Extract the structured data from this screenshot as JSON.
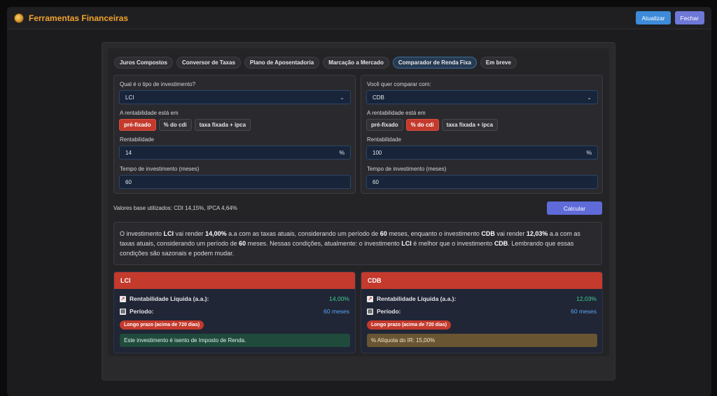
{
  "app": {
    "title": "Ferramentas Financeiras",
    "refresh_label": "Atualizar",
    "close_label": "Fechar"
  },
  "tabs": [
    {
      "label": "Juros Compostos"
    },
    {
      "label": "Conversor de Taxas"
    },
    {
      "label": "Plano de Aposentadoria"
    },
    {
      "label": "Marcação a Mercado"
    },
    {
      "label": "Comparador de Renda Fixa",
      "active": true
    },
    {
      "label": "Em breve"
    }
  ],
  "left_form": {
    "type_label": "Qual é o tipo de investimento?",
    "type_value": "LCI",
    "rate_mode_label": "A rentabilidade está em",
    "rate_modes": [
      "pré-fixado",
      "% do cdi",
      "taxa fixada + ipca"
    ],
    "selected_mode": "pré-fixado",
    "rate_label": "Rentabilidade",
    "rate_value": "14",
    "rate_unit": "%",
    "term_label": "Tempo de investimento (meses)",
    "term_value": "60"
  },
  "right_form": {
    "type_label": "Você quer comparar com:",
    "type_value": "CDB",
    "rate_mode_label": "A rentabilidade está em",
    "rate_modes": [
      "pré-fixado",
      "% do cdi",
      "taxa fixada + ipca"
    ],
    "selected_mode": "% do cdi",
    "rate_label": "Rentabilidade",
    "rate_value": "100",
    "rate_unit": "%",
    "term_label": "Tempo de investimento (meses)",
    "term_value": "60"
  },
  "base_values": "Valores base utilizados: CDI 14,15%, IPCA 4,64%",
  "calc_label": "Calcular",
  "summary": {
    "p1": "O investimento ",
    "b1": "LCI",
    "p2": " vai render ",
    "b2": "14,00%",
    "p3": " a.a com as taxas atuais, considerando um período de ",
    "b3": "60",
    "p4": " meses, enquanto o investimento ",
    "b4": "CDB",
    "p5": " vai render ",
    "b5": "12,03%",
    "p6": " a.a com as taxas atuais, considerando um período de ",
    "b6": "60",
    "p7": " meses. Nessas condições, atualmente: o investimento ",
    "b7": "LCI",
    "p8": " é melhor que o investimento ",
    "b8": "CDB",
    "p9": ". Lembrando que essas condições são sazonais e podem mudar."
  },
  "cards": [
    {
      "title": "LCI",
      "yield_label": "Rentabilidade Líquida (a.a.):",
      "yield_value": "14,00%",
      "period_label": "Período:",
      "period_value": "60 meses",
      "badge": "Longo prazo (acima de 720 dias)",
      "note": "Este investimento é isento de Imposto de Renda."
    },
    {
      "title": "CDB",
      "yield_label": "Rentabilidade Líquida (a.a.):",
      "yield_value": "12,03%",
      "period_label": "Período:",
      "period_value": "60 meses",
      "badge": "Longo prazo (acima de 720 dias)",
      "note": "% Alíquota do IR: 15,00%"
    }
  ],
  "colors": {
    "accent_orange": "#f2a32e",
    "selected_red": "#c43a2c",
    "positive_green": "#3fcf8f",
    "info_blue": "#5aa3f0"
  }
}
